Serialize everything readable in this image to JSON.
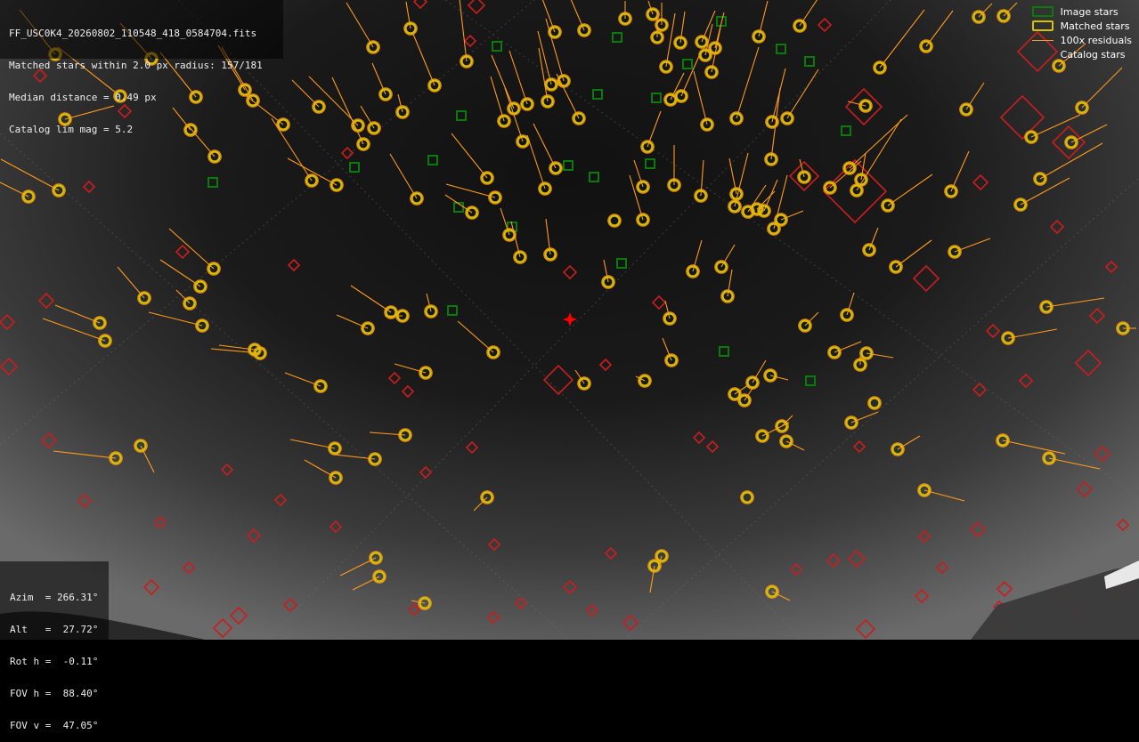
{
  "header": {
    "filename": "FF_USC0K4_20260802_110548_418_0584704.fits",
    "matched_line": "Matched stars within 2.0 px radius: 157/181",
    "median_line": "Median distance = 0.49 px",
    "catalog_line": "Catalog lim mag = 5.2"
  },
  "pointing": {
    "azim": "Azim  = 266.31°",
    "alt": "Alt   =  27.72°",
    "rot": "Rot h =  -0.11°",
    "fov_h": "FOV h =  88.40°",
    "fov_v": "FOV v =  47.05°"
  },
  "legend": {
    "image_stars": "Image stars",
    "matched_stars": "Matched stars",
    "residuals": "100x residuals",
    "catalog_stars": "Catalog stars"
  },
  "colors": {
    "image_star": "#0a7a0a",
    "matched_star": "#d8c200",
    "residual": "#ff9a1a",
    "catalog_star": "#c81e1e",
    "center_marker": "#ff0000"
  }
}
